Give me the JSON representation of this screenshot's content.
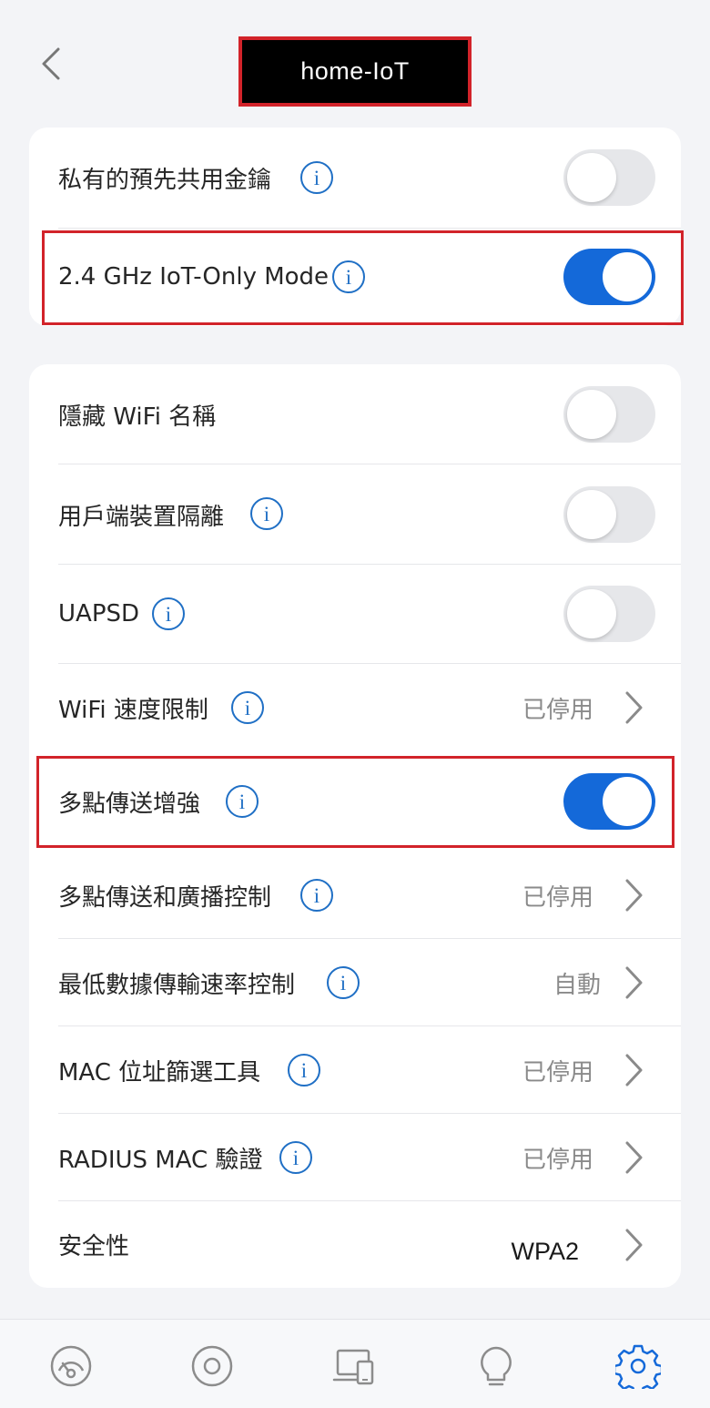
{
  "header": {
    "title": "home-IoT"
  },
  "section1": [
    {
      "label": "私有的預先共用金鑰",
      "has_info": true,
      "toggle": false
    },
    {
      "label": "2.4 GHz IoT-Only Mode",
      "has_info": true,
      "toggle": true
    }
  ],
  "section2": [
    {
      "label": "隱藏 WiFi 名稱",
      "has_info": false,
      "toggle": false
    },
    {
      "label": "用戶端裝置隔離",
      "has_info": true,
      "toggle": false
    },
    {
      "label": "UAPSD",
      "has_info": true,
      "toggle": false
    },
    {
      "label": "WiFi 速度限制",
      "has_info": true,
      "value": "已停用"
    },
    {
      "label": "多點傳送增強",
      "has_info": true,
      "toggle": true
    },
    {
      "label": "多點傳送和廣播控制",
      "has_info": true,
      "value": "已停用"
    },
    {
      "label": "最低數據傳輸速率控制",
      "has_info": true,
      "value": "自動"
    },
    {
      "label": "MAC 位址篩選工具",
      "has_info": true,
      "value": "已停用"
    },
    {
      "label": "RADIUS MAC 驗證",
      "has_info": true,
      "value": "已停用"
    },
    {
      "label": "安全性",
      "has_info": false,
      "value": "WPA2"
    }
  ],
  "info_glyph": "i",
  "bottom_nav": [
    {
      "icon": "dashboard-icon",
      "active": false
    },
    {
      "icon": "devices-circle-icon",
      "active": false
    },
    {
      "icon": "client-devices-icon",
      "active": false
    },
    {
      "icon": "insights-bulb-icon",
      "active": false
    },
    {
      "icon": "settings-gear-icon",
      "active": true
    }
  ],
  "colors": {
    "accent": "#1469d9",
    "info": "#1f6fc5",
    "highlight": "#d2232a",
    "background": "#f3f4f7"
  }
}
